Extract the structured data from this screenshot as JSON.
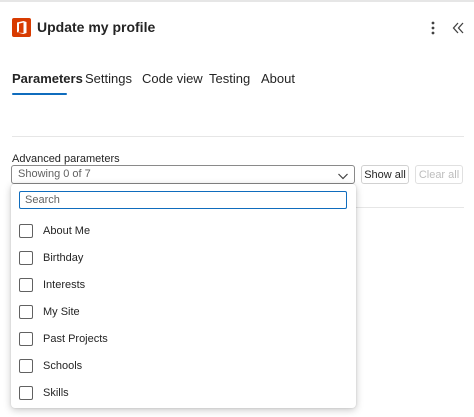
{
  "header": {
    "title": "Update my profile",
    "app_icon": "office-app-icon",
    "accent_color": "#d83b01"
  },
  "tabs": [
    {
      "label": "Parameters",
      "active": true
    },
    {
      "label": "Settings",
      "active": false
    },
    {
      "label": "Code view",
      "active": false
    },
    {
      "label": "Testing",
      "active": false
    },
    {
      "label": "About",
      "active": false
    }
  ],
  "advanced": {
    "label": "Advanced parameters",
    "selected_text": "Showing 0 of 7",
    "show_all_label": "Show all",
    "clear_all_label": "Clear all",
    "search_placeholder": "Search",
    "options": [
      {
        "label": "About Me",
        "checked": false
      },
      {
        "label": "Birthday",
        "checked": false
      },
      {
        "label": "Interests",
        "checked": false
      },
      {
        "label": "My Site",
        "checked": false
      },
      {
        "label": "Past Projects",
        "checked": false
      },
      {
        "label": "Schools",
        "checked": false
      },
      {
        "label": "Skills",
        "checked": false
      }
    ]
  },
  "colors": {
    "tab_underline": "#0f6cbd",
    "focus_border": "#0f6cbd"
  }
}
